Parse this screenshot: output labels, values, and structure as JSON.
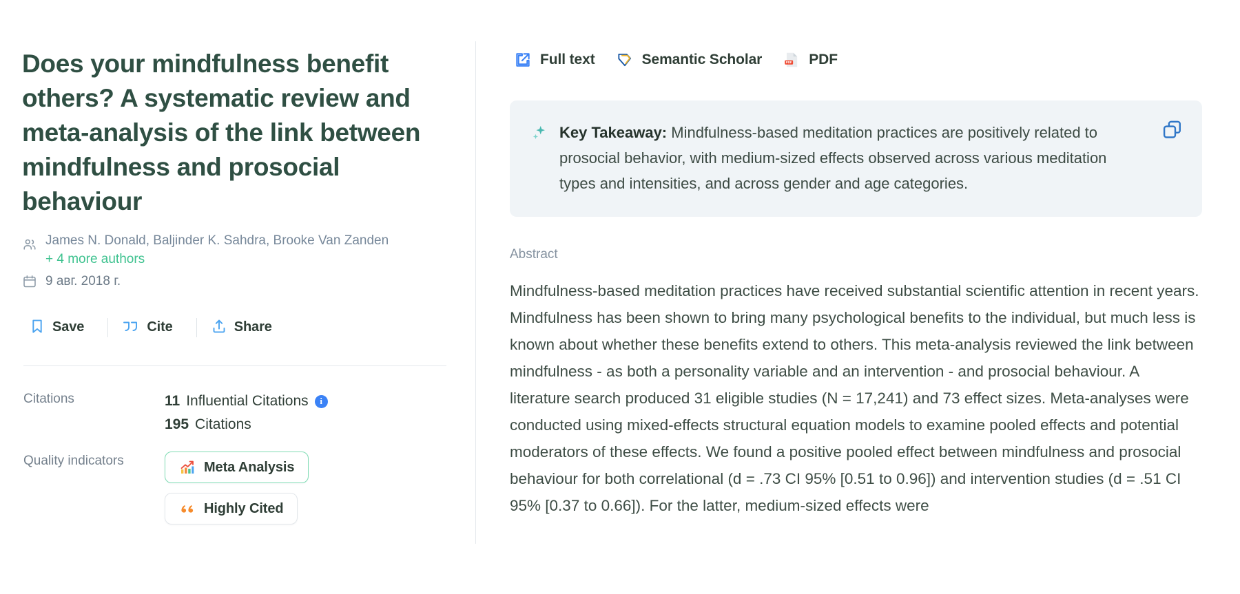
{
  "paper": {
    "title": "Does your mindfulness benefit others? A systematic review and meta-analysis of the link between mindfulness and prosocial behaviour",
    "authors": "James N. Donald, Baljinder K. Sahdra, Brooke Van Zanden",
    "more_authors": "+ 4 more authors",
    "date": "9 авг. 2018 г.",
    "authors_icon": "people-icon",
    "date_icon": "calendar-icon"
  },
  "actions": [
    {
      "label": "Save",
      "icon": "bookmark-icon"
    },
    {
      "label": "Cite",
      "icon": "quote-icon"
    },
    {
      "label": "Share",
      "icon": "share-upload-icon"
    }
  ],
  "citations": {
    "label": "Citations",
    "influential_count": "11",
    "influential_label": "Influential Citations",
    "info_icon": "info-icon",
    "info_glyph": "i",
    "total_count": "195",
    "total_label": "Citations"
  },
  "quality": {
    "label": "Quality indicators",
    "badges": [
      {
        "label": "Meta Analysis",
        "icon": "bar-chart-trend-icon",
        "accent": "#7fdcb4"
      },
      {
        "label": "Highly Cited",
        "icon": "orange-quote-icon",
        "accent": "#e2e6ea"
      }
    ]
  },
  "links": [
    {
      "label": "Full text",
      "icon": "external-link-icon"
    },
    {
      "label": "Semantic Scholar",
      "icon": "semantic-scholar-icon"
    },
    {
      "label": "PDF",
      "icon": "pdf-file-icon"
    }
  ],
  "takeaway": {
    "heading": "Key Takeaway:",
    "body": " Mindfulness-based meditation practices are positively related to prosocial behavior, with medium-sized effects observed across various meditation types and intensities, and across gender and age categories.",
    "sparkle_icon": "sparkle-icon",
    "copy_icon": "copy-icon"
  },
  "abstract": {
    "label": "Abstract",
    "body": "Mindfulness-based meditation practices have received substantial scientific attention in recent years. Mindfulness has been shown to bring many psychological benefits to the individual, but much less is known about whether these benefits extend to others. This meta-analysis reviewed the link between mindfulness - as both a personality variable and an intervention - and prosocial behaviour. A literature search produced 31 eligible studies (N = 17,241) and 73 effect sizes. Meta-analyses were conducted using mixed-effects structural equation models to examine pooled effects and potential moderators of these effects. We found a positive pooled effect between mindfulness and prosocial behaviour for both correlational (d = .73 CI 95% [0.51 to 0.96]) and intervention studies (d = .51 CI 95% [0.37 to 0.66]). For the latter, medium-sized effects were"
  },
  "colors": {
    "title": "#2f4f43",
    "accent_green": "#3ec28f",
    "link_blue": "#3b82f6",
    "takeaway_bg": "#f0f4f7",
    "muted": "#77889a",
    "divider": "#e4e8ec"
  }
}
